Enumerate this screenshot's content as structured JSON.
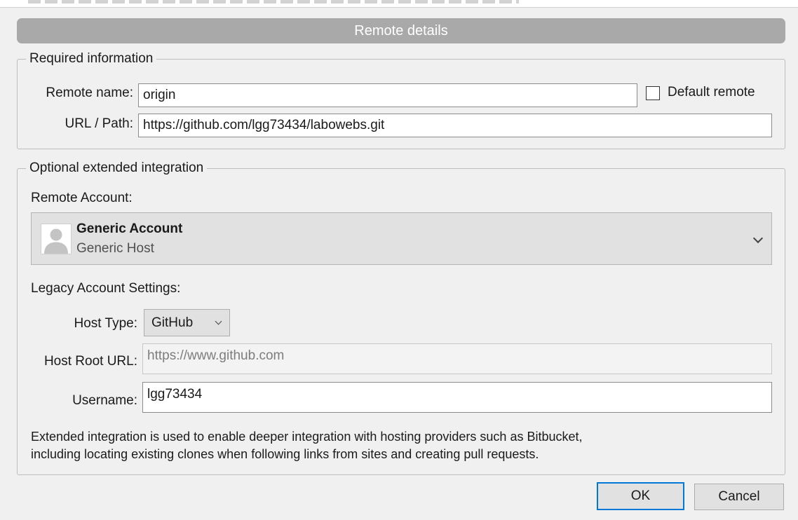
{
  "dialog": {
    "title": "Remote details"
  },
  "required": {
    "legend": "Required information",
    "remote_name_label": "Remote name:",
    "remote_name_value": "origin",
    "default_remote_label": "Default remote",
    "default_remote_checked": false,
    "url_label": "URL / Path:",
    "url_value": "https://github.com/lgg73434/labowebs.git"
  },
  "optional": {
    "legend": "Optional extended integration",
    "remote_account_label": "Remote Account:",
    "account": {
      "name": "Generic Account",
      "host": "Generic Host",
      "icon": "user-avatar-icon"
    },
    "legacy_label": "Legacy Account Settings:",
    "host_type_label": "Host Type:",
    "host_type_value": "GitHub",
    "host_root_label": "Host Root URL:",
    "host_root_value": "https://www.github.com",
    "username_label": "Username:",
    "username_value": "lgg73434",
    "description_line1": "Extended integration is used to enable deeper integration with hosting providers such as Bitbucket,",
    "description_line2": "including locating existing clones when following links from sites and creating pull requests."
  },
  "buttons": {
    "ok": "OK",
    "cancel": "Cancel"
  },
  "colors": {
    "title_bar": "#a9a9a9",
    "default_button_border": "#0078d7",
    "window_bg": "#f0f0f0"
  }
}
